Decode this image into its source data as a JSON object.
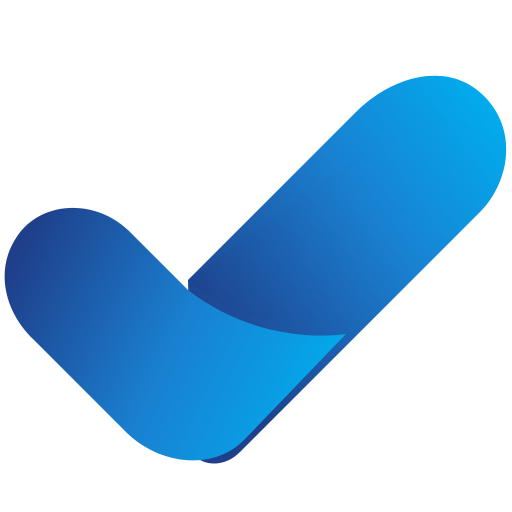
{
  "logo": {
    "icon": "checkmark-icon",
    "colors": {
      "dark_blue": "#1f3f8a",
      "mid_blue": "#1a7fd0",
      "light_blue": "#00aeef",
      "background": "#ffffff"
    }
  }
}
